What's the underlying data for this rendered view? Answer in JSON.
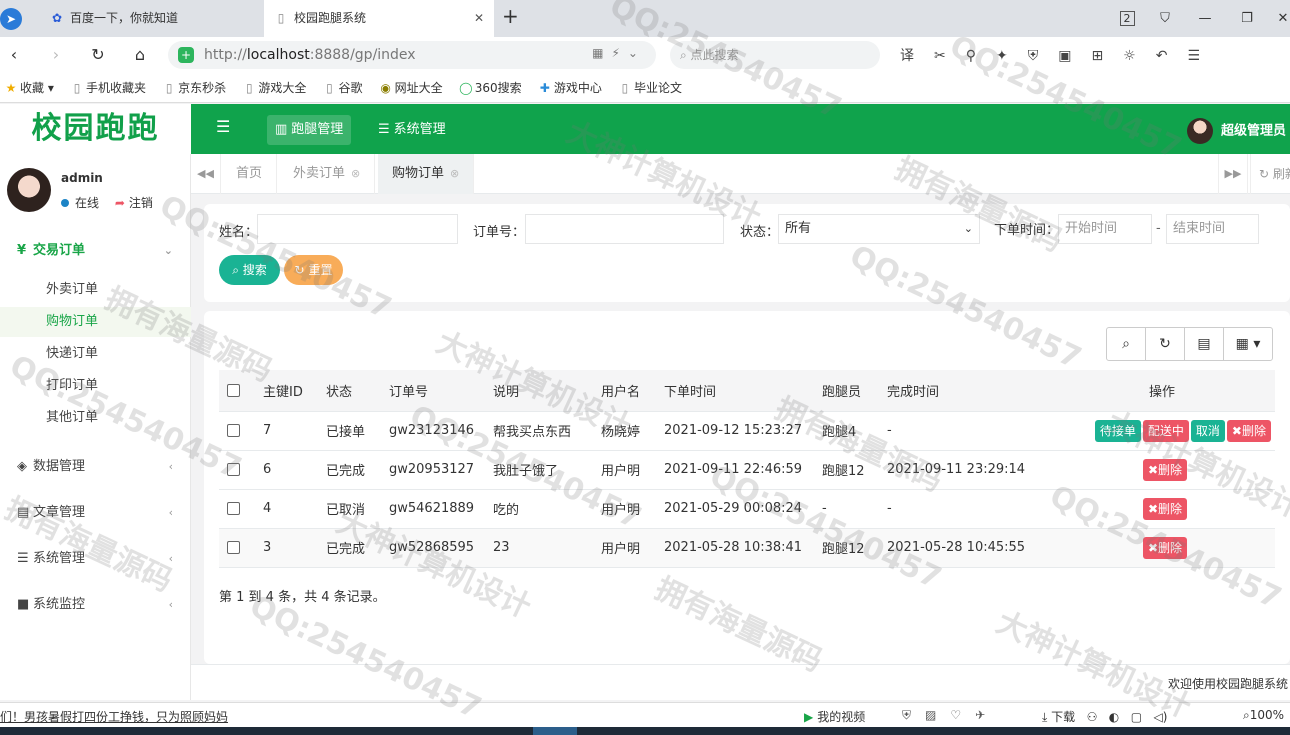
{
  "browser": {
    "tabs": [
      {
        "label": "百度一下，你就知道",
        "icon": "paw-icon"
      },
      {
        "label": "校园跑腿系统",
        "icon": "page-icon"
      }
    ],
    "tab_counter": "2",
    "url_scheme": "http://",
    "url_host": "localhost",
    "url_rest": ":8888/gp/index",
    "search_placeholder": "点此搜索",
    "bookmarks": [
      "收藏",
      "手机收藏夹",
      "京东秒杀",
      "游戏大全",
      "谷歌",
      "网址大全",
      "360搜索",
      "游戏中心",
      "毕业论文"
    ],
    "status_news": "们！男孩暑假打四份工挣钱，只为照顾妈妈",
    "status_video": "我的视频",
    "status_download": "下载",
    "zoom": "100%"
  },
  "app": {
    "logo": "校园跑跑",
    "top_nav": [
      "跑腿管理",
      "系统管理"
    ],
    "header_user": "超级管理员",
    "user": {
      "name": "admin",
      "online": "在线",
      "logout": "注销"
    },
    "sidebar": {
      "group_trade": "交易订单",
      "items": [
        "外卖订单",
        "购物订单",
        "快递订单",
        "打印订单",
        "其他订单"
      ],
      "group_data": "数据管理",
      "group_article": "文章管理",
      "group_system": "系统管理",
      "group_monitor": "系统监控"
    },
    "content_tabs": [
      "首页",
      "外卖订单",
      "购物订单"
    ],
    "refresh_label": "刷新",
    "search": {
      "name_label": "姓名：",
      "order_label": "订单号：",
      "status_label": "状态：",
      "status_value": "所有",
      "time_label": "下单时间：",
      "start_placeholder": "开始时间",
      "end_placeholder": "结束时间",
      "dash": "-",
      "search_btn": "搜索",
      "reset_btn": "重置"
    },
    "table": {
      "columns": [
        "主键ID",
        "状态",
        "订单号",
        "说明",
        "用户名",
        "下单时间",
        "跑腿员",
        "完成时间",
        "操作"
      ],
      "rows": [
        {
          "id": "7",
          "status": "已接单",
          "order_no": "gw23123146",
          "desc": "帮我买点东西",
          "user": "杨晓婷",
          "order_time": "2021-09-12 15:23:27",
          "runner": "跑腿4",
          "done_time": "-"
        },
        {
          "id": "6",
          "status": "已完成",
          "order_no": "gw20953127",
          "desc": "我肚子饿了",
          "user": "用户明",
          "order_time": "2021-09-11 22:46:59",
          "runner": "跑腿12",
          "done_time": "2021-09-11 23:29:14"
        },
        {
          "id": "4",
          "status": "已取消",
          "order_no": "gw54621889",
          "desc": "吃的",
          "user": "用户明",
          "order_time": "2021-05-29 00:08:24",
          "runner": "-",
          "done_time": "-"
        },
        {
          "id": "3",
          "status": "已完成",
          "order_no": "gw52868595",
          "desc": "23",
          "user": "用户明",
          "order_time": "2021-05-28 10:38:41",
          "runner": "跑腿12",
          "done_time": "2021-05-28 10:45:55"
        }
      ],
      "ops_pending": "待接单",
      "ops_delivering": "配送中",
      "ops_cancel": "取消",
      "ops_delete": "删除"
    },
    "pager": "第 1 到 4 条，共 4 条记录。",
    "footer": "欢迎使用校园跑腿系统"
  },
  "watermarks": [
    "QQ:254540457",
    "大神计算机设计",
    "拥有海量源码"
  ],
  "colors": {
    "brand_green": "#10a34c",
    "teal": "#1ab394",
    "red": "#ed5565",
    "orange": "#f8ac59"
  }
}
